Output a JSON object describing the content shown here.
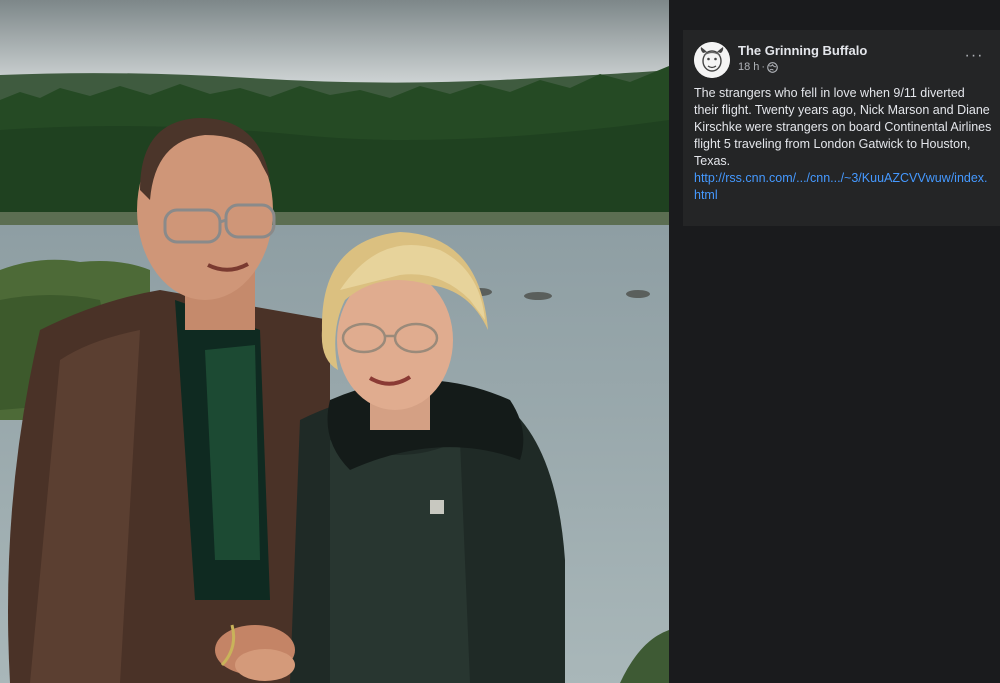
{
  "photo": {
    "alt_description": ""
  },
  "post": {
    "author": "The Grinning Buffalo",
    "time": "18 h",
    "separator": "·",
    "text": "The strangers who fell in love when 9/11 diverted their flight. Twenty years ago, Nick Marson and Diane Kirschke were strangers on board Continental Airlines flight 5 traveling from London Gatwick to Houston, Texas.",
    "link": "http://rss.cnn.com/.../cnn.../~3/KuuAZCVVwuw/index.html",
    "more_label": "···",
    "privacy_icon": "globe-icon",
    "avatar_icon": "buffalo-avatar"
  },
  "colors": {
    "card_bg": "#242526",
    "page_bg": "#1a1b1d",
    "text": "#e4e6eb",
    "muted": "#b0b3b8",
    "link": "#4599ff"
  }
}
